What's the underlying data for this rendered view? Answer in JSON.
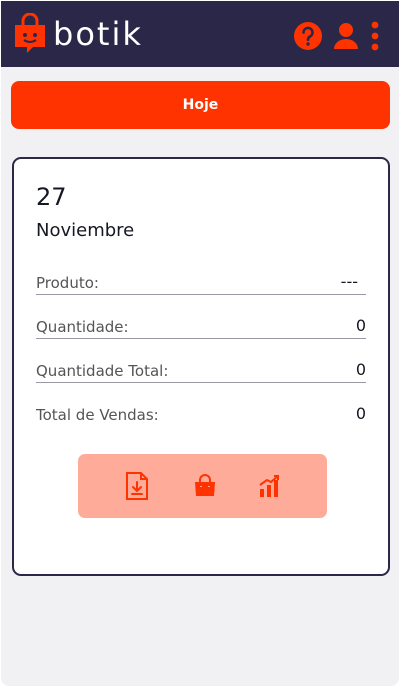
{
  "app": {
    "brand": "botik"
  },
  "header": {
    "icons": [
      "help-circle-icon",
      "user-icon",
      "more-vert-icon"
    ],
    "accent_color": "#ff3300",
    "bar_color": "#2b2748"
  },
  "main": {
    "today_button": "Hoje"
  },
  "card": {
    "day": "27",
    "month": "Noviembre",
    "rows": [
      {
        "label": "Produto:",
        "value": "---"
      },
      {
        "label": "Quantidade:",
        "value": "0"
      },
      {
        "label": "Quantidade Total:",
        "value": "0"
      },
      {
        "label": "Total de Vendas:",
        "value": "0"
      }
    ],
    "action_icons": [
      "download-file-icon",
      "shopping-bag-icon",
      "bar-chart-icon"
    ]
  }
}
